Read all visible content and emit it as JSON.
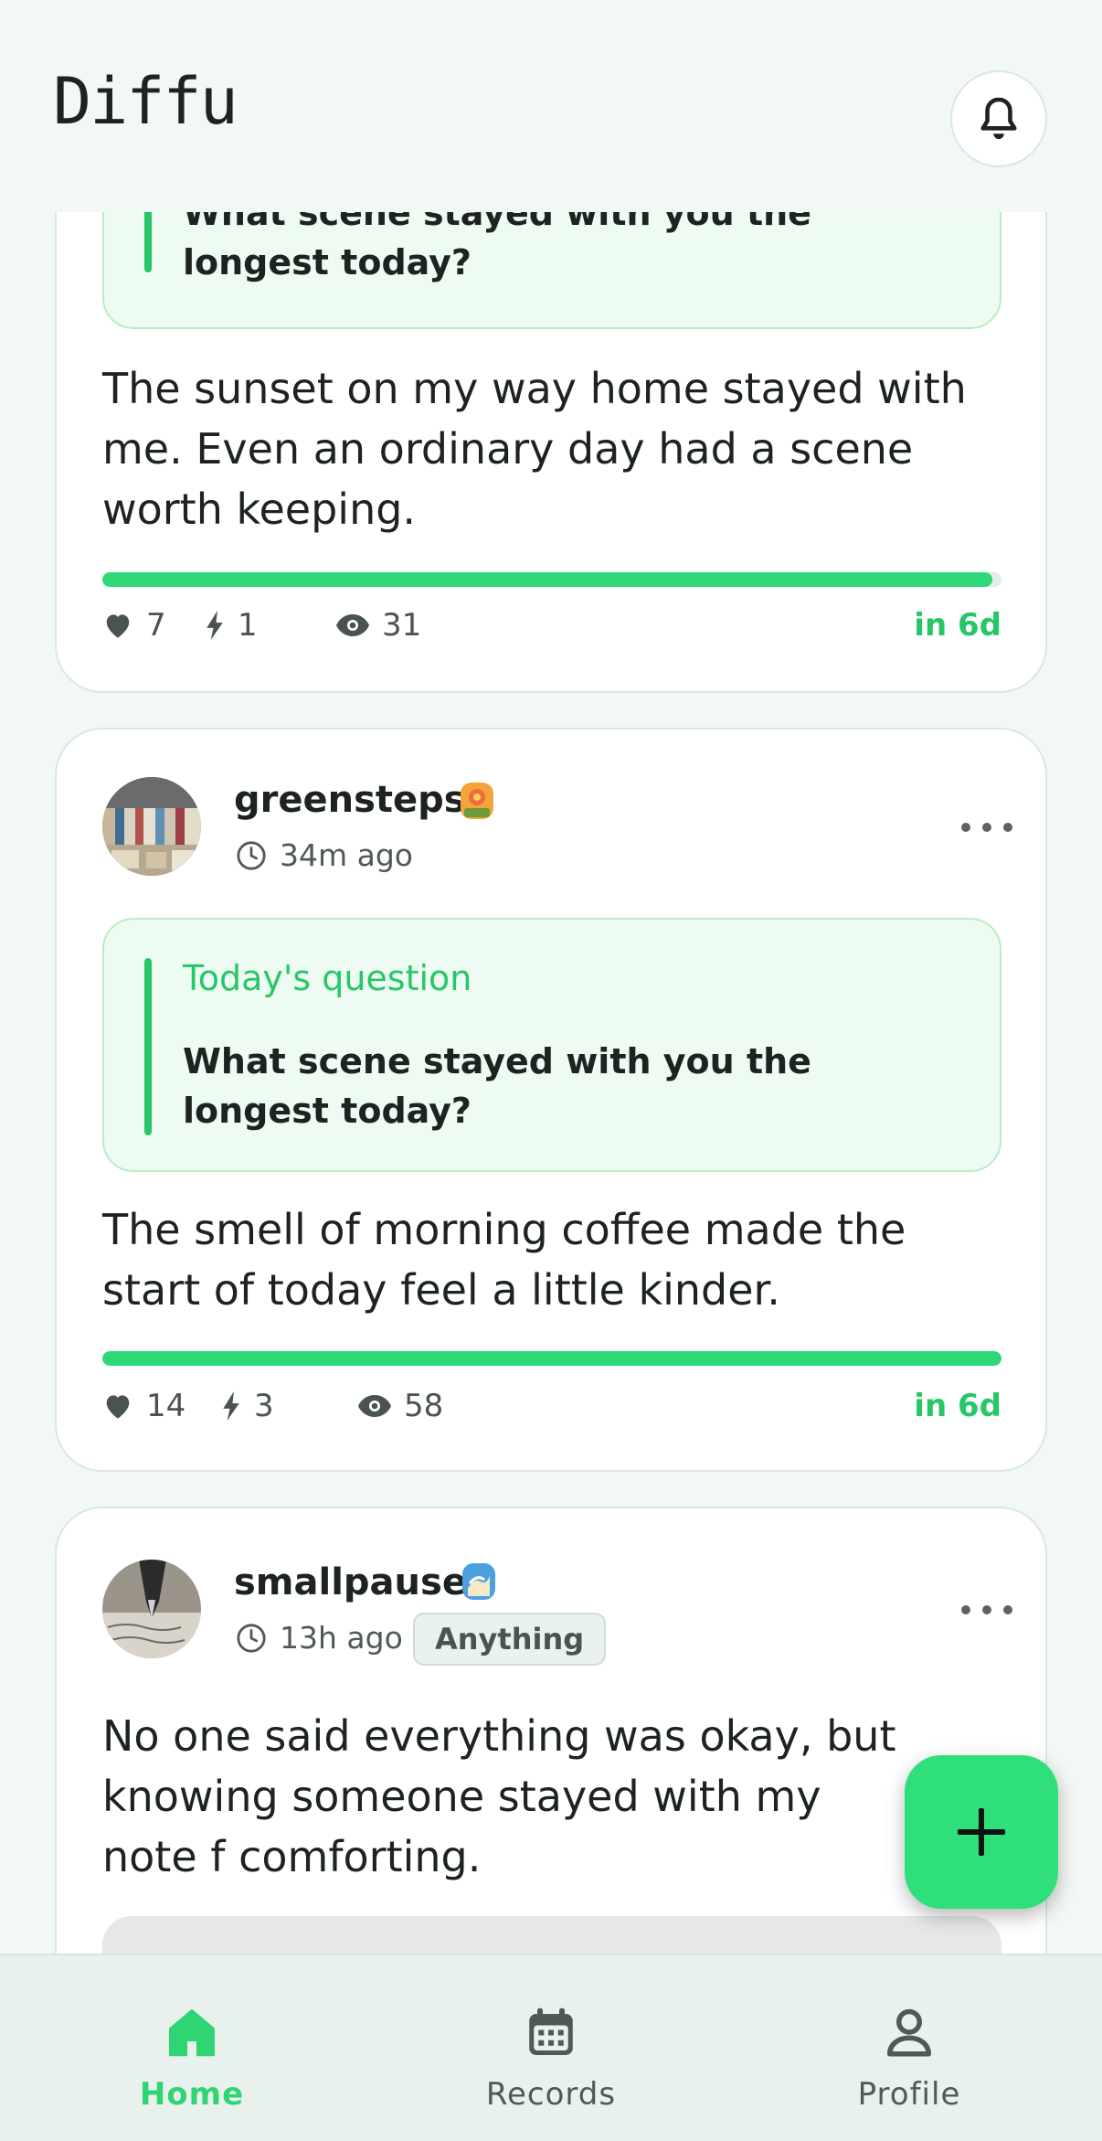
{
  "app": {
    "title": "Diffu"
  },
  "header": {
    "notification_icon": "bell-icon"
  },
  "posts": [
    {
      "question_text": "What scene stayed with you the longest today?",
      "body": "The sunset on my way home stayed with me. Even an ordinary day had a scene worth keeping.",
      "progress": 0.99,
      "stats": {
        "likes": "7",
        "sparks": "1",
        "views": "31"
      },
      "expires": "in 6d"
    },
    {
      "username": "greensteps",
      "badge_icon": "flower-badge-icon",
      "time_ago": "34m ago",
      "question_label": "Today's question",
      "question_text": "What scene stayed with you the longest today?",
      "body": "The smell of morning coffee made the start of today feel a little kinder.",
      "progress": 1.0,
      "stats": {
        "likes": "14",
        "sparks": "3",
        "views": "58"
      },
      "expires": "in 6d"
    },
    {
      "username": "smallpause",
      "badge_icon": "wave-badge-icon",
      "time_ago": "13h ago",
      "tag": "Anything",
      "body": "No one said everything was okay, but knowing someone stayed with my note f comforting."
    }
  ],
  "fab": {
    "icon": "plus-icon"
  },
  "nav": [
    {
      "label": "Home",
      "icon": "home-icon",
      "active": true
    },
    {
      "label": "Records",
      "icon": "calendar-icon",
      "active": false
    },
    {
      "label": "Profile",
      "icon": "person-icon",
      "active": false
    }
  ],
  "colors": {
    "accent": "#2ed876",
    "background": "#f2f8f4",
    "card": "#ffffff",
    "question_bg": "#eefbf2"
  }
}
